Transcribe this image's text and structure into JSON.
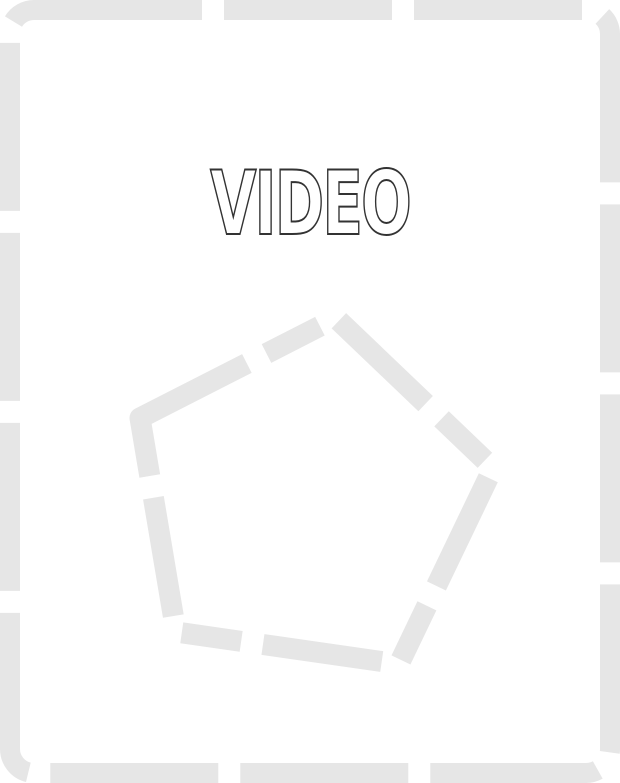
{
  "card": {
    "title": "VIDEO"
  },
  "icons": {
    "frame": "dashed-rounded-frame",
    "shape": "dashed-pentagon-icon"
  },
  "colors": {
    "background": "#ffffff",
    "dash": "#e6e6e6",
    "title_fill": "#ffffff",
    "title_stroke": "#333333"
  }
}
